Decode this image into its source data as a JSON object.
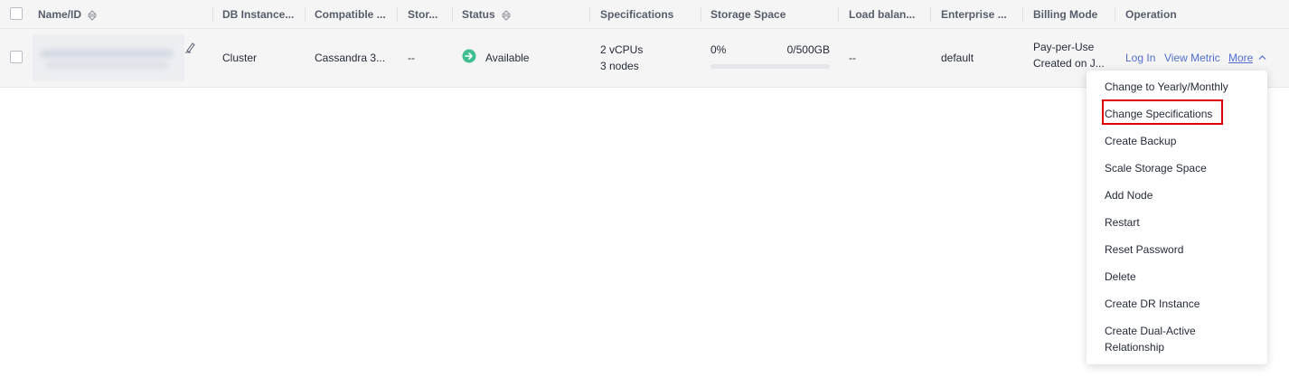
{
  "columns": {
    "name": "Name/ID",
    "db_instance": "DB Instance...",
    "compatible": "Compatible ...",
    "storage": "Stor...",
    "status": "Status",
    "specifications": "Specifications",
    "storage_space": "Storage Space",
    "load_balancer": "Load balan...",
    "enterprise": "Enterprise ...",
    "billing_mode": "Billing Mode",
    "operation": "Operation"
  },
  "row": {
    "db_instance_type": "Cluster",
    "compatible_api": "Cassandra 3...",
    "storage_type": "--",
    "status": "Available",
    "spec_vcpus": "2 vCPUs",
    "spec_nodes": "3 nodes",
    "storage_percent": "0%",
    "storage_usage": "0/500GB",
    "storage_used_fraction": 0.0,
    "load_balancer": "--",
    "enterprise_project": "default",
    "billing_mode": "Pay-per-Use",
    "billing_created": "Created on J...",
    "op_login": "Log In",
    "op_view_metric": "View Metric",
    "op_more": "More"
  },
  "more_menu": {
    "items": [
      "Change to Yearly/Monthly",
      "Change Specifications",
      "Create Backup",
      "Scale Storage Space",
      "Add Node",
      "Restart",
      "Reset Password",
      "Delete",
      "Create DR Instance",
      "Create Dual-Active",
      "Relationship"
    ],
    "highlighted": "Change Specifications"
  },
  "colors": {
    "accent": "#526ecc",
    "status_available": "#3fbf8f",
    "highlight_box": "#e00000",
    "header_bg": "#f5f5f6"
  }
}
